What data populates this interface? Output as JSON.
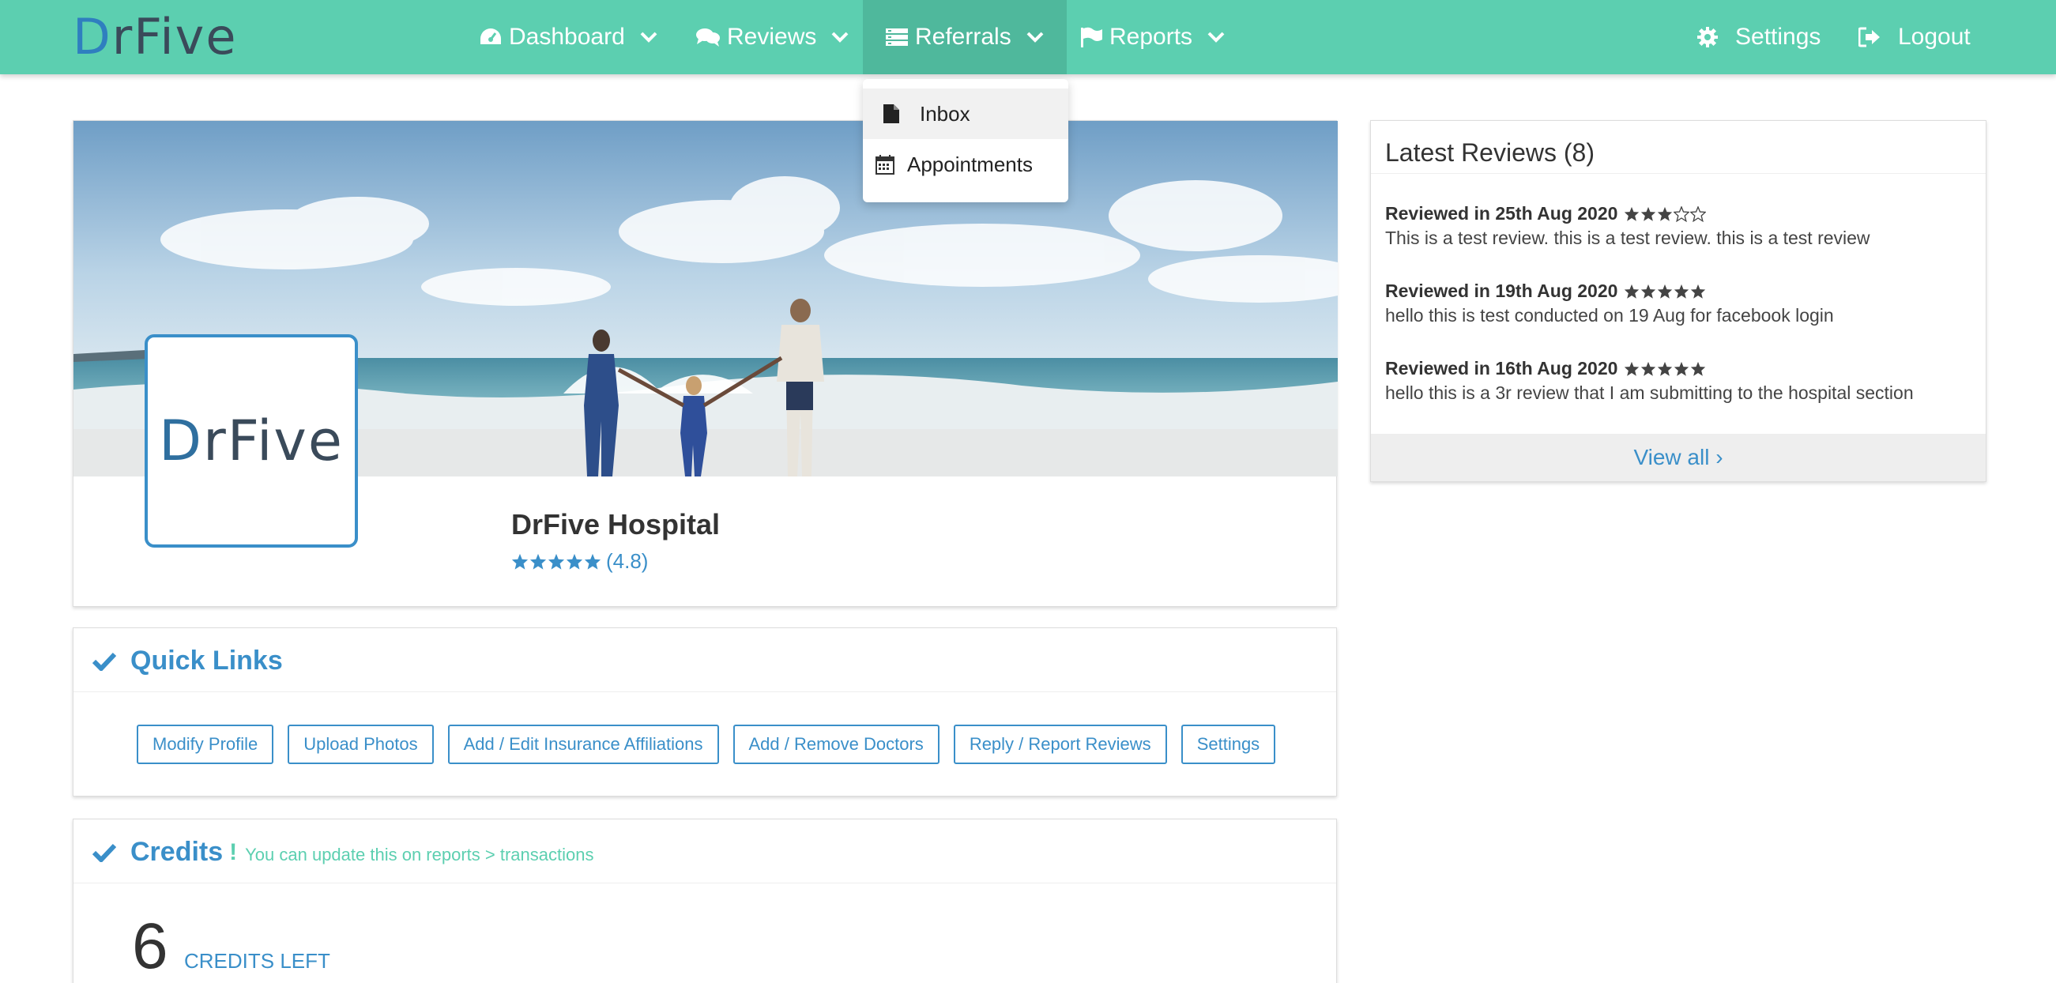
{
  "brand": {
    "logo_part1": "D",
    "logo_part2": "r",
    "logo_part3": "Five"
  },
  "nav": {
    "dashboard": "Dashboard",
    "reviews": "Reviews",
    "referrals": "Referrals",
    "reports": "Reports",
    "settings": "Settings",
    "logout": "Logout"
  },
  "referrals_menu": {
    "items": [
      {
        "label": "Inbox",
        "icon": "file-icon"
      },
      {
        "label": "Appointments",
        "icon": "calendar-icon"
      }
    ]
  },
  "profile": {
    "avatar_logo_d": "D",
    "avatar_logo_rest": "rFive",
    "name": "DrFive Hospital",
    "rating": "(4.8)"
  },
  "quick_links": {
    "title": "Quick Links",
    "buttons": [
      "Modify Profile",
      "Upload Photos",
      "Add / Edit Insurance Affiliations",
      "Add / Remove Doctors",
      "Reply / Report Reviews",
      "Settings"
    ]
  },
  "credits": {
    "title": "Credits",
    "bang": "!",
    "note": "You can update this on reports > transactions",
    "count": "6",
    "label": "CREDITS LEFT"
  },
  "latest_reviews": {
    "title": "Latest Reviews (8)",
    "items": [
      {
        "heading": "Reviewed in 25th Aug 2020",
        "stars": 3,
        "text": "This is a test review. this is a test review. this is a test review"
      },
      {
        "heading": "Reviewed in 19th Aug 2020",
        "stars": 5,
        "text": "hello this is test conducted on 19 Aug for facebook login"
      },
      {
        "heading": "Reviewed in 16th Aug 2020",
        "stars": 5,
        "text": "hello this is a 3r review that I am submitting to the hospital section"
      }
    ],
    "view_all": "View all ›"
  },
  "colors": {
    "nav_bg": "#5ccfb0",
    "nav_active": "#4fb89c",
    "accent_blue": "#3a8fc9",
    "accent_green": "#5ccfb0"
  }
}
